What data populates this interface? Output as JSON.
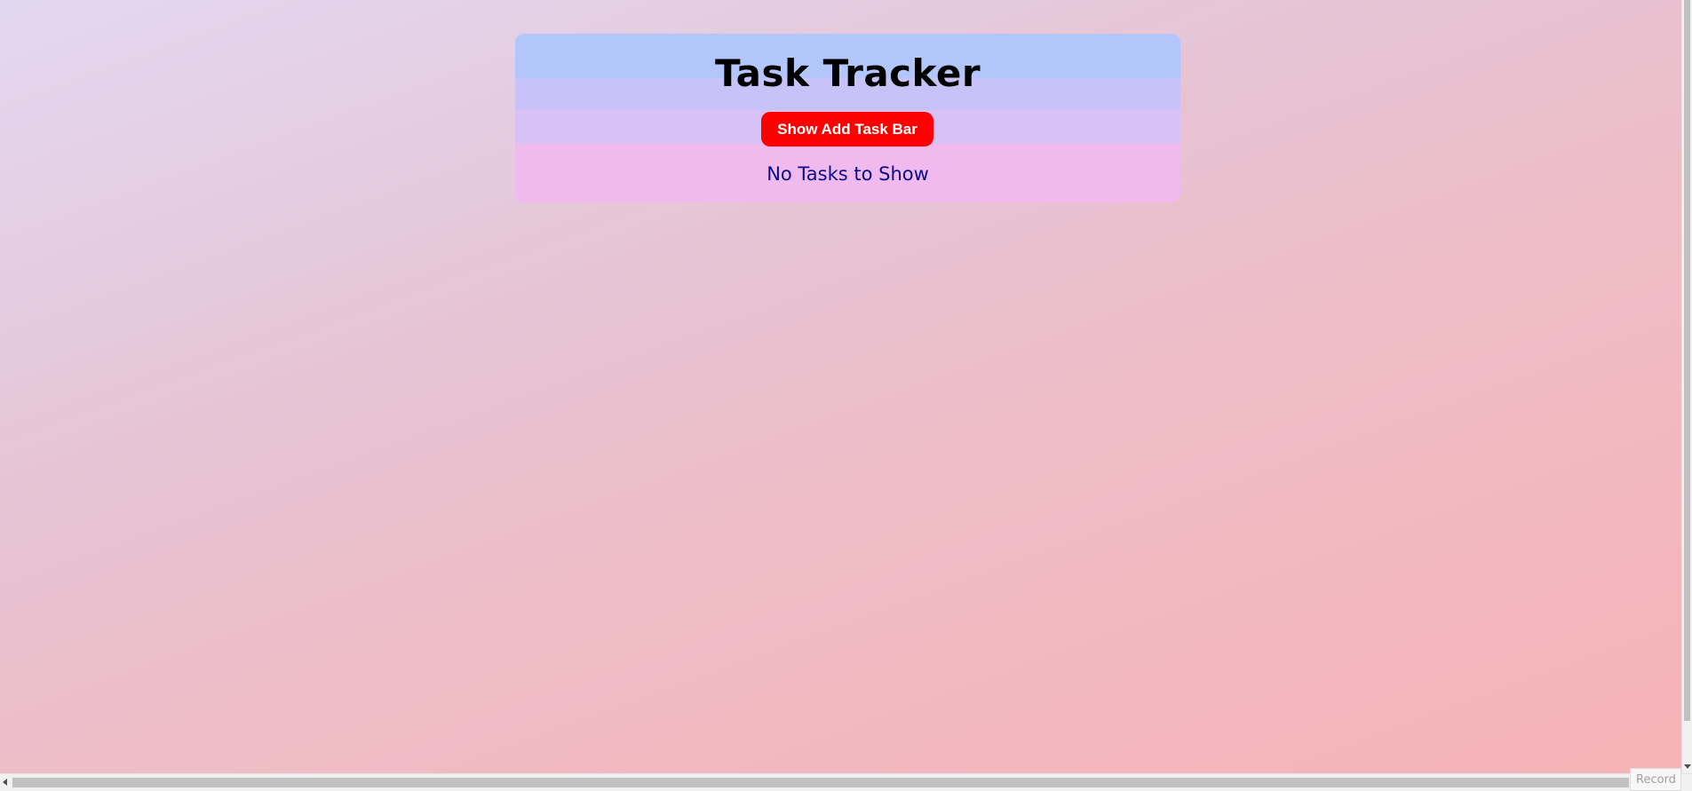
{
  "app": {
    "title": "Task Tracker"
  },
  "header": {
    "toggle_button_label": "Show Add Task Bar"
  },
  "tasks": {
    "items": [],
    "empty_message": "No Tasks to Show"
  },
  "overlay": {
    "record_label": "Record"
  },
  "colors": {
    "button_bg": "#ff0000",
    "button_text": "#ffffff",
    "empty_text": "#0b0b8a",
    "title_text": "#000000"
  }
}
